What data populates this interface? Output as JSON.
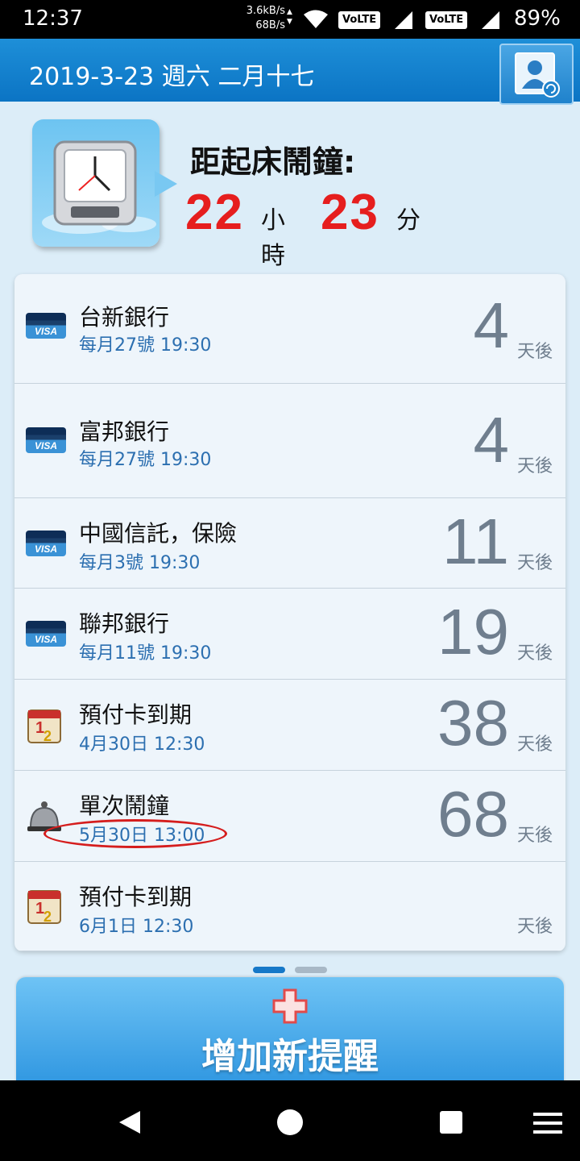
{
  "status_bar": {
    "time": "12:37",
    "net_up": "3.6kB/s",
    "net_down": "68B/s",
    "volte_1": "VoLTE",
    "volte_2": "VoLTE",
    "battery": "89%"
  },
  "header": {
    "date": "2019-3-23 週六 二月十七"
  },
  "alarm": {
    "title": "距起床鬧鐘:",
    "hours": "22",
    "hours_unit": "小時",
    "minutes": "23",
    "minutes_unit": "分"
  },
  "reminders": [
    {
      "icon": "credit-card-icon",
      "name": "台新銀行",
      "schedule": "每月27號 19:30",
      "days": "4",
      "unit": "天後"
    },
    {
      "icon": "credit-card-icon",
      "name": "富邦銀行",
      "schedule": "每月27號 19:30",
      "days": "4",
      "unit": "天後"
    },
    {
      "icon": "credit-card-icon",
      "name": "中國信託，保險",
      "schedule": "每月3號 19:30",
      "days": "11",
      "unit": "天後"
    },
    {
      "icon": "credit-card-icon",
      "name": "聯邦銀行",
      "schedule": "每月11號 19:30",
      "days": "19",
      "unit": "天後"
    },
    {
      "icon": "calendar-icon",
      "name": "預付卡到期",
      "schedule": "4月30日 12:30",
      "days": "38",
      "unit": "天後"
    },
    {
      "icon": "bell-icon",
      "name": "單次鬧鐘",
      "schedule": "5月30日 13:00",
      "days": "68",
      "unit": "天後"
    },
    {
      "icon": "calendar-icon",
      "name": "預付卡到期",
      "schedule": "6月1日 12:30",
      "days": "",
      "unit": "天後"
    }
  ],
  "card_brand": "VISA",
  "add_button": {
    "label": "增加新提醒"
  },
  "colors": {
    "header_blue": "#0b74c4",
    "countdown_red": "#e61e1e",
    "schedule_blue": "#2c6fb0",
    "days_gray": "#6f7e8e",
    "highlight_red": "#d51d1d"
  }
}
